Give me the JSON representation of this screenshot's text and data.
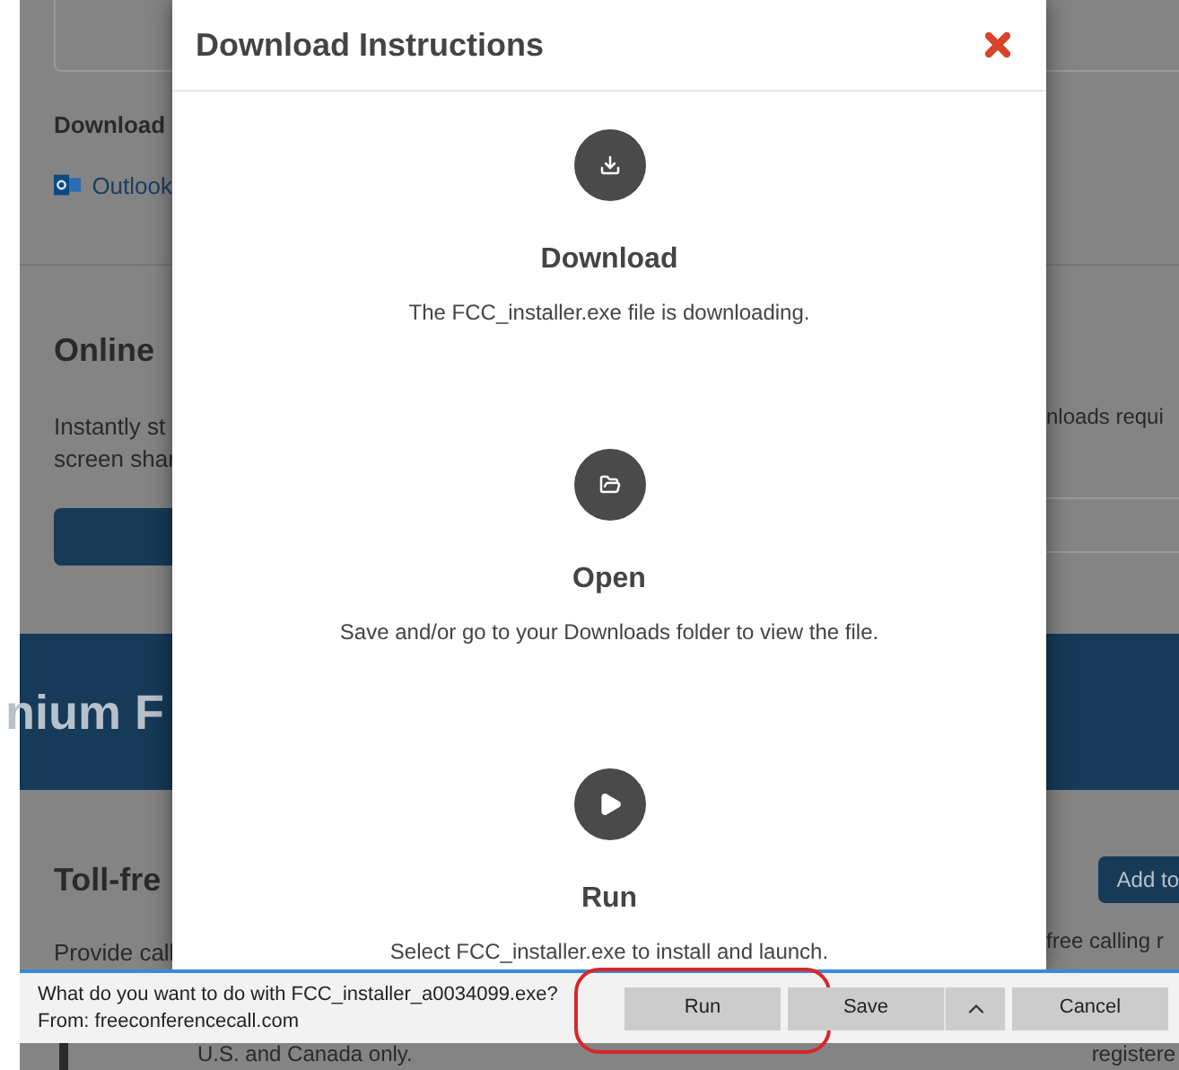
{
  "page": {
    "download_heading": "Download",
    "outlook_link": "Outlook",
    "online_heading": "Online",
    "online_text": [
      "Instantly st",
      "screen shar"
    ],
    "online_text_right": "nloads requi",
    "banner_heading": "nium F",
    "tollfree_heading": "Toll-fre",
    "add_button": "Add to",
    "tollfree_text_left": "Provide call",
    "tollfree_text_right": "free calling r",
    "footer_left": "U.S. and Canada only.",
    "footer_right": "registere"
  },
  "dialog": {
    "title": "Download Instructions",
    "steps": [
      {
        "kind": "download",
        "title": "Download",
        "text": "The FCC_installer.exe file is downloading."
      },
      {
        "kind": "open",
        "title": "Open",
        "text": "Save and/or go to your Downloads folder to view the file."
      },
      {
        "kind": "run",
        "title": "Run",
        "text": "Select FCC_installer.exe to install and launch."
      }
    ]
  },
  "download_bar": {
    "prompt": "What do you want to do with FCC_installer_a0034099.exe?",
    "source": "From: freeconferencecall.com",
    "buttons": [
      {
        "label": "Run",
        "kind": "plain",
        "highlighted": true
      },
      {
        "label": "Save",
        "kind": "split",
        "highlighted": false
      },
      {
        "label": "Cancel",
        "kind": "plain",
        "highlighted": false
      }
    ]
  }
}
